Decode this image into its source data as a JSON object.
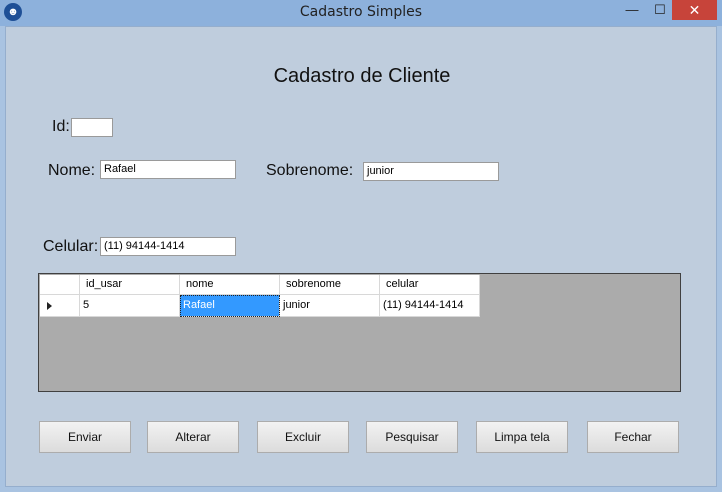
{
  "window": {
    "title": "Cadastro Simples",
    "min_glyph": "—",
    "max_glyph": "☐",
    "close_glyph": "✕",
    "app_icon": "person-icon"
  },
  "form": {
    "heading": "Cadastro de Cliente",
    "id_label": "Id:",
    "id_value": "",
    "nome_label": "Nome:",
    "nome_value": "Rafael",
    "sobrenome_label": "Sobrenome:",
    "sobrenome_value": "junior",
    "celular_label": "Celular:",
    "celular_value": "(11) 94144-1414"
  },
  "grid": {
    "columns": [
      "id_usar",
      "nome",
      "sobrenome",
      "celular"
    ],
    "rows": [
      [
        "5",
        "Rafael",
        "junior",
        "(11) 94144-1414"
      ]
    ]
  },
  "buttons": [
    "Enviar",
    "Alterar",
    "Excluir",
    "Pesquisar",
    "Limpa tela",
    "Fechar"
  ]
}
